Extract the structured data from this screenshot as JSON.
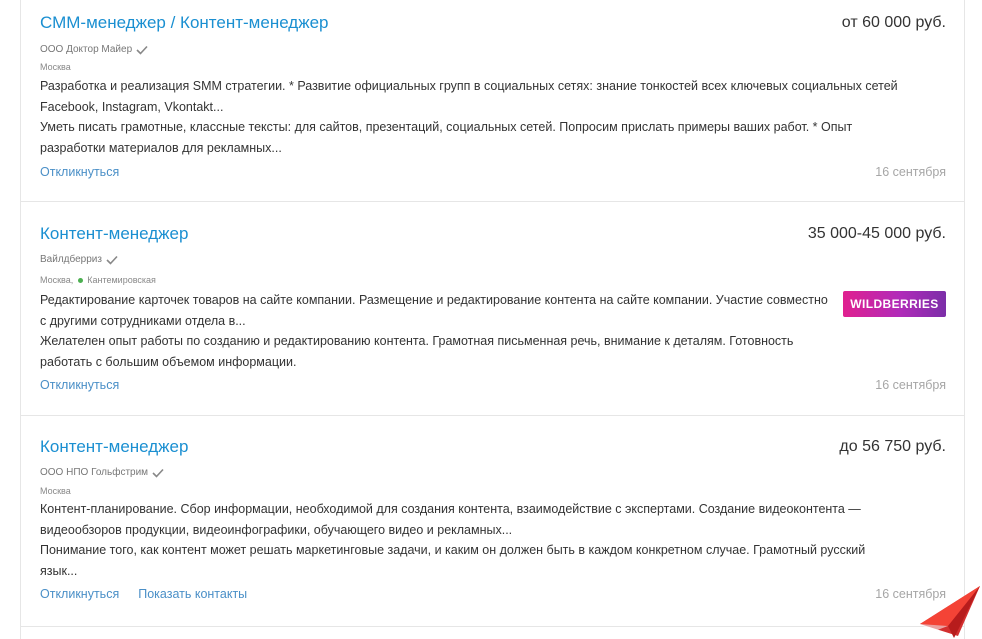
{
  "vacancies": [
    {
      "title": "СММ-менеджер / Контент-менеджер",
      "salary": "от 60 000 руб.",
      "company": "ООО Доктор Майер",
      "city": "Москва",
      "metro": "",
      "desc1": "Разработка и реализация SMM стратегии. * Развитие официальных групп в социальных сетях: знание тонкостей всех ключевых социальных сетей Facebook, Instagram, Vkontakt...",
      "desc2": "Уметь писать грамотные, классные тексты: для сайтов, презентаций, социальных сетей. Попросим прислать примеры ваших работ. * Опыт разработки материалов для рекламных...",
      "respond": "Откликнуться",
      "contacts": "",
      "date": "16 сентября"
    },
    {
      "title": "Контент-менеджер",
      "salary": "35 000-45 000 руб.",
      "company": "Вайлдберриз",
      "city": "Москва,",
      "metro": "Кантемировская",
      "metro_color": "#4caf50",
      "logo_text": "WILDBERRIES",
      "desc1": "Редактирование карточек товаров на сайте компании. Размещение и редактирование контента на сайте компании. Участие совместно с другими сотрудниками отдела в...",
      "desc2": "Желателен опыт работы по созданию и редактированию контента. Грамотная письменная речь, внимание к деталям. Готовность работать с большим объемом информации.",
      "respond": "Откликнуться",
      "contacts": "",
      "date": "16 сентября"
    },
    {
      "title": "Контент-менеджер",
      "salary": "до 56 750 руб.",
      "company": "ООО НПО Гольфстрим",
      "city": "Москва",
      "metro": "",
      "desc1": "Контент-планирование. Сбор информации, необходимой для создания контента, взаимодействие с экспертами. Создание видеоконтента — видеообзоров продукции, видеоинфографики, обучающего видео и рекламных...",
      "desc2": "Понимание того, как контент может решать маркетинговые задачи, и каким он должен быть в каждом конкретном случае. Грамотный русский язык...",
      "respond": "Откликнуться",
      "contacts": "Показать контакты",
      "date": "16 сентября"
    }
  ],
  "icons": {
    "verified": "check-icon",
    "metro": "metro-dot-icon",
    "corner": "paper-plane-icon"
  },
  "colors": {
    "link": "#1a8fd1",
    "action": "#4a8fc7",
    "date": "#a6a6a6",
    "accent_plane": "#e53935"
  }
}
